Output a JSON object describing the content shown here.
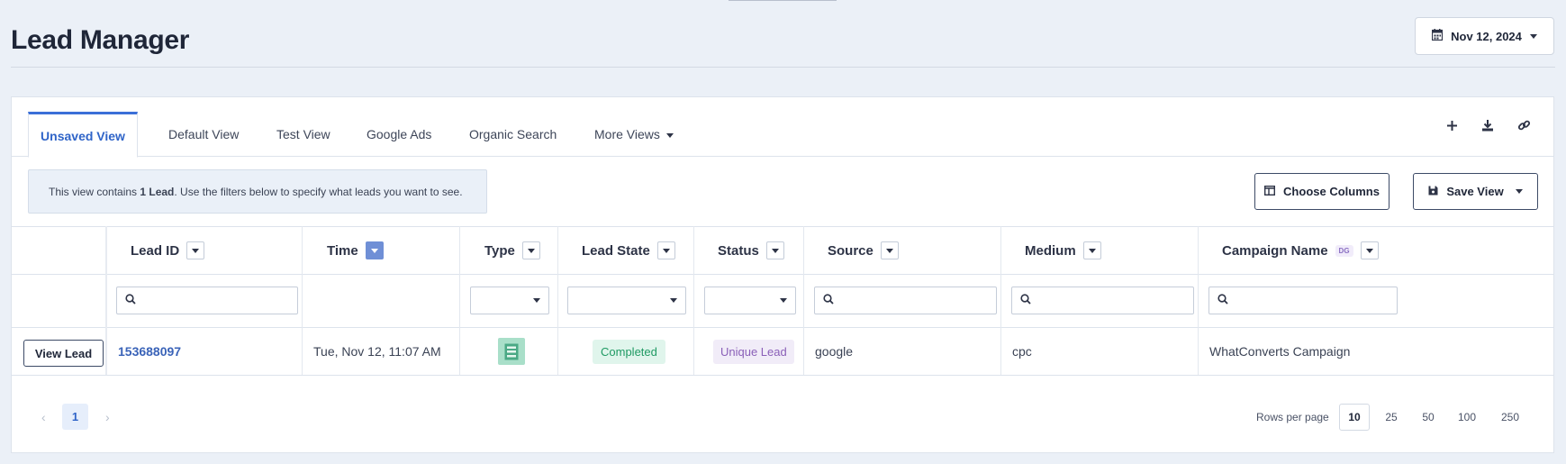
{
  "page": {
    "title": "Lead Manager",
    "date": "Nov 12, 2024"
  },
  "tabs": [
    "Unsaved View",
    "Default View",
    "Test View",
    "Google Ads",
    "Organic Search",
    "More Views"
  ],
  "info": {
    "prefix": "This view contains ",
    "count": "1 Lead",
    "suffix": ". Use the filters below to specify what leads you want to see."
  },
  "buttons": {
    "choose_columns": "Choose Columns",
    "save_view": "Save View",
    "view_lead": "View Lead"
  },
  "columns": {
    "lead_id": "Lead ID",
    "time": "Time",
    "type": "Type",
    "lead_state": "Lead State",
    "status": "Status",
    "source": "Source",
    "medium": "Medium",
    "campaign": "Campaign Name",
    "campaign_badge": "DG"
  },
  "row": {
    "lead_id": "153688097",
    "time": "Tue, Nov 12, 11:07 AM",
    "type_icon": "form-icon",
    "lead_state": "Completed",
    "status": "Unique Lead",
    "source": "google",
    "medium": "cpc",
    "campaign": "WhatConverts Campaign"
  },
  "pagination": {
    "prev": "‹",
    "next": "›",
    "current": "1",
    "rows_label": "Rows per page",
    "options": [
      "10",
      "25",
      "50",
      "100",
      "250"
    ],
    "selected": "10"
  },
  "colors": {
    "accent": "#3b6fd8",
    "completed": "#1f9a63",
    "unique": "#8a5fb8",
    "form_icon_bg": "#a9dfc9"
  }
}
